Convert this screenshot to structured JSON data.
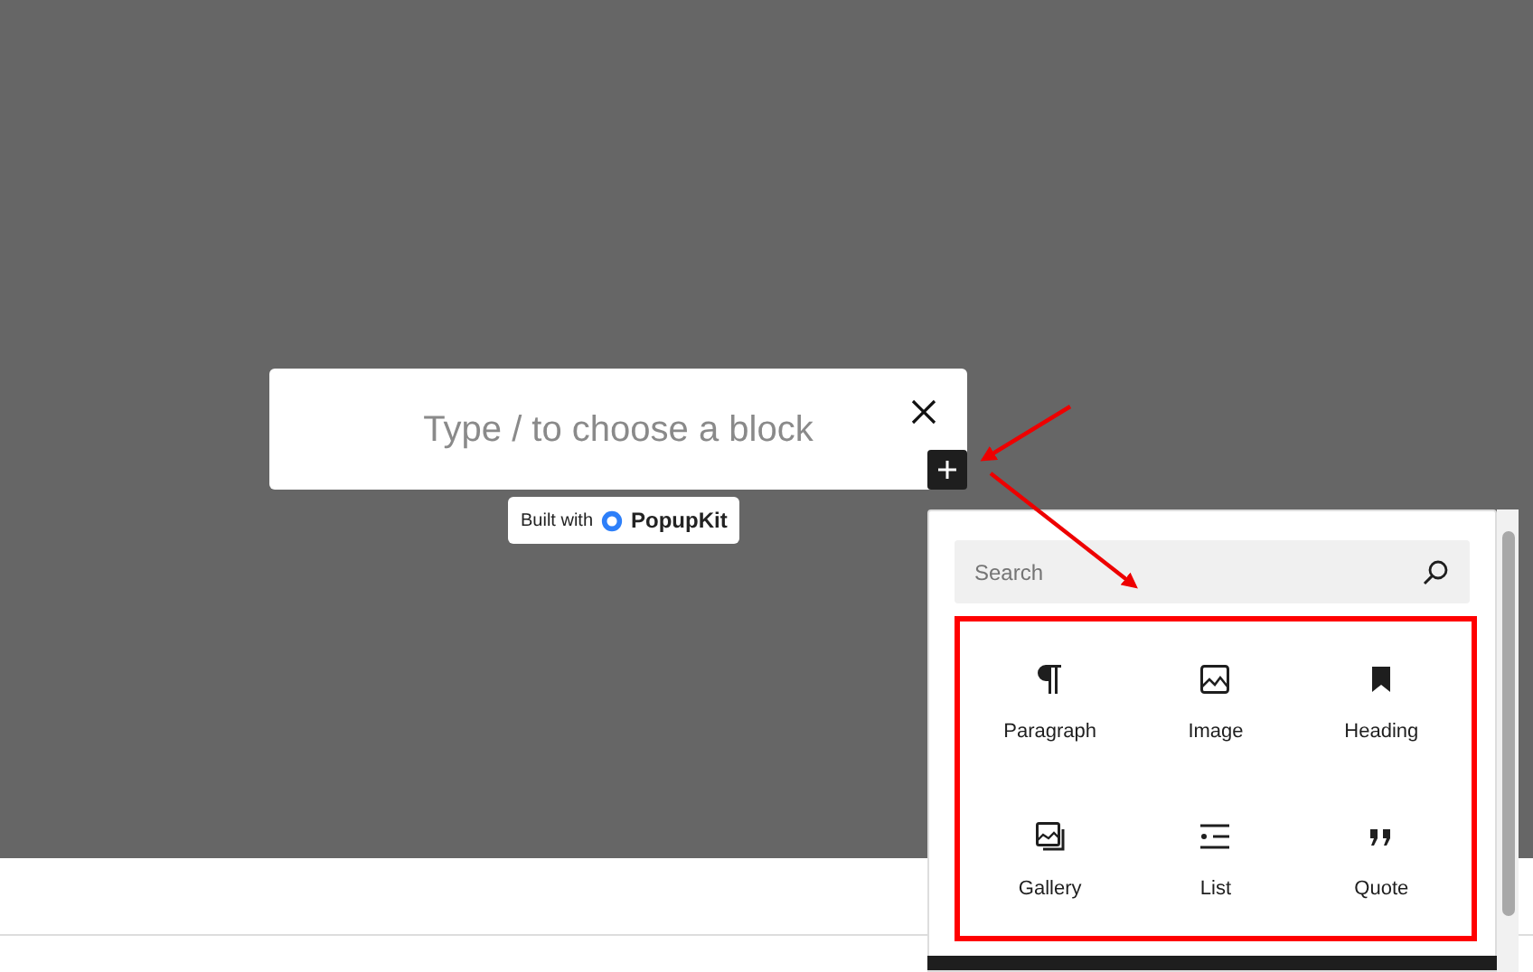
{
  "editor": {
    "placeholder": "Type / to choose a block"
  },
  "badge": {
    "prefix": "Built with",
    "brand": "PopupKit"
  },
  "inserter": {
    "search": {
      "placeholder": "Search"
    },
    "blocks": [
      {
        "label": "Paragraph"
      },
      {
        "label": "Image"
      },
      {
        "label": "Heading"
      },
      {
        "label": "Gallery"
      },
      {
        "label": "List"
      },
      {
        "label": "Quote"
      }
    ]
  }
}
